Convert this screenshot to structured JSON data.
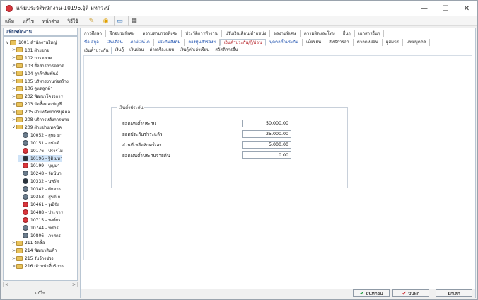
{
  "window": {
    "title": "แฟ้มประวัติพนักงาน-10196.ฐิติ มหาวงษ์",
    "minimize": "—",
    "maximize": "☐",
    "close": "✕"
  },
  "menu": [
    {
      "label": "แฟ้ม"
    },
    {
      "label": "แก้ไข"
    },
    {
      "label": "หน้าต่าง"
    },
    {
      "label": "วิธีใช้"
    }
  ],
  "toolbar": [
    {
      "icon": "pencil-icon",
      "glyph": "✎"
    },
    {
      "icon": "help-icon",
      "glyph": "◉"
    },
    {
      "icon": "monitor-icon",
      "glyph": "▭"
    },
    {
      "icon": "calculator-icon",
      "glyph": "▦"
    }
  ],
  "tree": {
    "header": "แฟ้มพนักงาน",
    "nodes": [
      {
        "label": "1001 สำนักงานใหญ่",
        "depth": 0,
        "kind": "folder",
        "exp": "∨"
      },
      {
        "label": "101 ฝ่ายขาย",
        "depth": 1,
        "kind": "folder",
        "exp": ">"
      },
      {
        "label": "102 การตลาด",
        "depth": 1,
        "kind": "folder",
        "exp": ">"
      },
      {
        "label": "103 สื่อสารการตลาด",
        "depth": 1,
        "kind": "folder",
        "exp": ">"
      },
      {
        "label": "104 ลูกค้าสัมพันธ์",
        "depth": 1,
        "kind": "folder",
        "exp": ">"
      },
      {
        "label": "105 บริหารงานก่อสร้าง",
        "depth": 1,
        "kind": "folder",
        "exp": ">"
      },
      {
        "label": "106 ดูแลลูกค้า",
        "depth": 1,
        "kind": "folder",
        "exp": ">"
      },
      {
        "label": "202 พัฒนาโครงการ",
        "depth": 1,
        "kind": "folder",
        "exp": ">"
      },
      {
        "label": "203 จัดซื้อและบัญชี",
        "depth": 1,
        "kind": "folder",
        "exp": ">"
      },
      {
        "label": "205 ฝ่ายทรัพยากรบุคคล",
        "depth": 1,
        "kind": "folder",
        "exp": ">"
      },
      {
        "label": "208 บริการหลังการขาย",
        "depth": 1,
        "kind": "folder",
        "exp": ">"
      },
      {
        "label": "209 ฝ่ายช่างเทคนิค",
        "depth": 1,
        "kind": "folder",
        "exp": "∨"
      },
      {
        "label": "10052 - สุพร มา",
        "depth": 2,
        "kind": "pic",
        "exp": ""
      },
      {
        "label": "10151 - อนันต์",
        "depth": 2,
        "kind": "pic",
        "exp": ""
      },
      {
        "label": "10176 - ปรารโม",
        "depth": 2,
        "kind": "red",
        "exp": ""
      },
      {
        "label": "10196 - ฐิติ มหา",
        "depth": 2,
        "kind": "dk",
        "exp": ""
      },
      {
        "label": "10199 - บุญมา",
        "depth": 2,
        "kind": "red",
        "exp": ""
      },
      {
        "label": "10248 - รัตน์นา",
        "depth": 2,
        "kind": "pic",
        "exp": ""
      },
      {
        "label": "10332 - นพรัต",
        "depth": 2,
        "kind": "dk",
        "exp": ""
      },
      {
        "label": "10342 - ศักดาร",
        "depth": 2,
        "kind": "pic",
        "exp": ""
      },
      {
        "label": "10353 - สุขดี ก",
        "depth": 2,
        "kind": "pic",
        "exp": ""
      },
      {
        "label": "10461 - วุฒิชัย",
        "depth": 2,
        "kind": "red",
        "exp": ""
      },
      {
        "label": "10488 - ประชาร",
        "depth": 2,
        "kind": "red",
        "exp": ""
      },
      {
        "label": "10715 - พงศ์กร",
        "depth": 2,
        "kind": "red",
        "exp": ""
      },
      {
        "label": "10744 - ทศกร",
        "depth": 2,
        "kind": "pic",
        "exp": ""
      },
      {
        "label": "10806 - ภาสกร",
        "depth": 2,
        "kind": "pic",
        "exp": ""
      },
      {
        "label": "211 จัดซื้อ",
        "depth": 1,
        "kind": "folder",
        "exp": ">"
      },
      {
        "label": "214 พัฒนาสินค้า",
        "depth": 1,
        "kind": "folder",
        "exp": ">"
      },
      {
        "label": "215 รับจ้างช่วง",
        "depth": 1,
        "kind": "folder",
        "exp": ">"
      },
      {
        "label": "216 เจ้าหน้าที่บริการ",
        "depth": 1,
        "kind": "folder",
        "exp": ">"
      }
    ],
    "scroll_left": "<",
    "scroll_right": ">",
    "status": "แก้ไข"
  },
  "tabs_row1": [
    {
      "label": "การศึกษา"
    },
    {
      "label": "ฝึกอบรมพิเศษ"
    },
    {
      "label": "ความสามารถพิเศษ"
    },
    {
      "label": "ประวัติการทำงาน"
    },
    {
      "label": "ปรับเงินเดือน/ตำแหน่ง"
    },
    {
      "label": "ผลงานพิเศษ"
    },
    {
      "label": "ความผิดและโทษ"
    },
    {
      "label": "อื่นๆ"
    },
    {
      "label": "เอกสารอื่นๆ"
    }
  ],
  "tabs_row2": [
    {
      "label": "ชื่อ-สกุล"
    },
    {
      "label": "เงินเดือน"
    },
    {
      "label": "ภาษีเงินได้"
    },
    {
      "label": "ประกันสังคม"
    },
    {
      "label": "กองทุนสำรองฯ"
    },
    {
      "label": "เงินค้ำประกัน/กู้/ผ่อน"
    },
    {
      "label": "บุคคลค้ำประกัน"
    },
    {
      "label": "เบี้ยขยัน"
    },
    {
      "label": "สิทธิการลา"
    },
    {
      "label": "ค่าลดหย่อน"
    },
    {
      "label": "ผู้สมรส"
    },
    {
      "label": "แฟ้มบุคคล"
    }
  ],
  "subtabs": [
    {
      "label": "เงินค้ำประกัน"
    },
    {
      "label": "เงินกู้"
    },
    {
      "label": "เงินผ่อน"
    },
    {
      "label": "ค่าเครื่องแบบ"
    },
    {
      "label": "เงินกู้ค่าเล่าเรียน"
    },
    {
      "label": "สวัสดิการอื่น"
    }
  ],
  "guarantee": {
    "group_title": "เงินค้ำประกัน",
    "fields": [
      {
        "label": "ยอดเงินค้ำประกัน",
        "value": "50,000.00"
      },
      {
        "label": "ยอดประกันชำระแล้ว",
        "value": "25,000.00"
      },
      {
        "label": "ส่วนที่เหลือหักครั้งละ",
        "value": "5,000.00"
      },
      {
        "label": "ยอดเงินค้ำประกันจ่ายคืน",
        "value": "0.00"
      }
    ]
  },
  "buttons": {
    "save_close": "บันทึกจบ",
    "save": "บันทึก",
    "cancel": "ยกเลิก",
    "check": "✔"
  }
}
